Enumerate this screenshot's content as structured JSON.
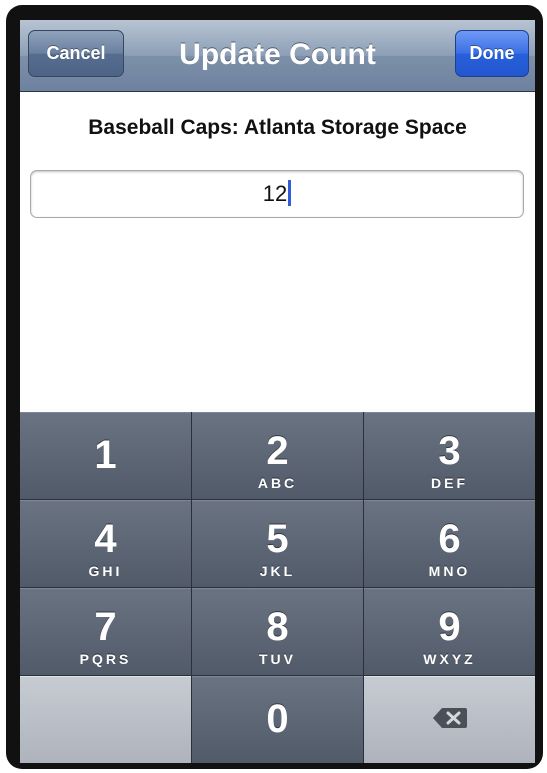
{
  "nav": {
    "cancel_label": "Cancel",
    "title": "Update Count",
    "done_label": "Done"
  },
  "item": {
    "label": "Baseball Caps: Atlanta Storage Space"
  },
  "count_field": {
    "value": "12"
  },
  "keypad": {
    "keys": [
      {
        "digit": "1",
        "letters": ""
      },
      {
        "digit": "2",
        "letters": "ABC"
      },
      {
        "digit": "3",
        "letters": "DEF"
      },
      {
        "digit": "4",
        "letters": "GHI"
      },
      {
        "digit": "5",
        "letters": "JKL"
      },
      {
        "digit": "6",
        "letters": "MNO"
      },
      {
        "digit": "7",
        "letters": "PQRS"
      },
      {
        "digit": "8",
        "letters": "TUV"
      },
      {
        "digit": "9",
        "letters": "WXYZ"
      },
      {
        "digit": "0",
        "letters": ""
      }
    ],
    "delete_icon": "backspace-icon"
  },
  "colors": {
    "nav_bar": "#7d90a9",
    "done_button": "#2760db",
    "keypad_key": "#515a69",
    "caret": "#2f5ed8"
  }
}
